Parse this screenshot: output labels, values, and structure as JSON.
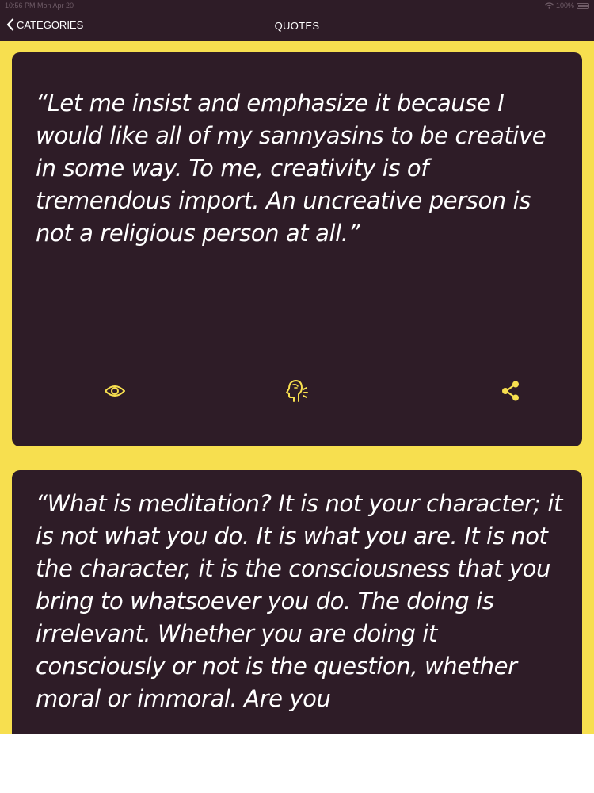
{
  "status_bar": {
    "time": "10:56 PM  Mon Apr 20",
    "battery": "100%"
  },
  "nav": {
    "back_label": "CATEGORIES",
    "title": "QUOTES"
  },
  "quotes": [
    {
      "text": "“Let me insist and emphasize it because I would like all of my sannyasins to be creative in some way. To me, creativity is of tremendous import. An uncreative person is not a religious person at all.”"
    },
    {
      "text": "“What is meditation? It is not your character; it is not what you do. It is what you are. It is not the character, it is the consciousness that you bring to whatsoever you do. The doing is irrelevant. Whether you are doing it consciously or not is the question, whether moral or immoral. Are you"
    }
  ],
  "icons": {
    "view": "eye-icon",
    "speak": "speaking-head-icon",
    "share": "share-icon"
  },
  "colors": {
    "background": "#f7df4f",
    "card": "#2e1c27",
    "accent": "#f7df4f",
    "text": "#ffffff"
  }
}
